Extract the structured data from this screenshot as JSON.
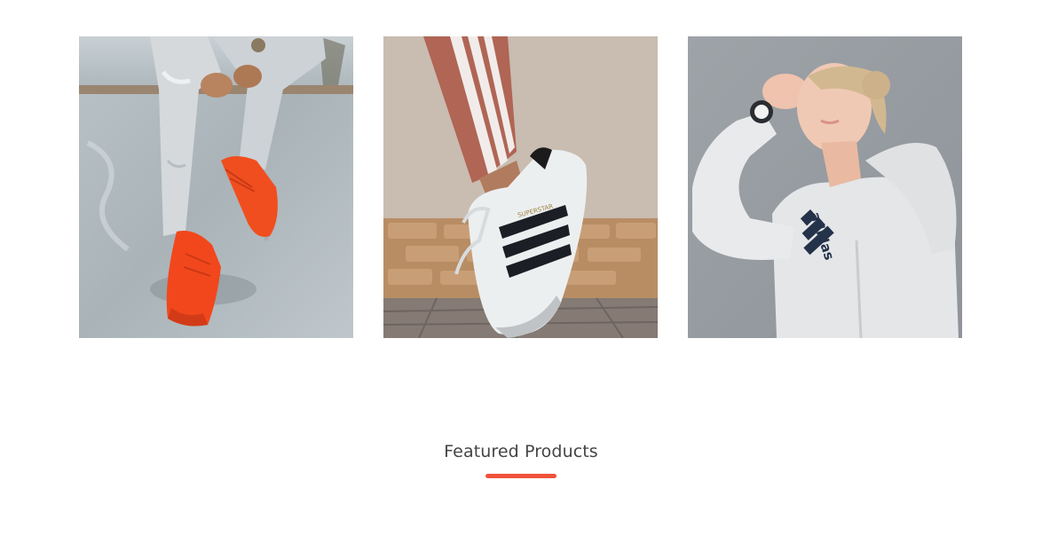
{
  "gallery": {
    "items": [
      {
        "id": "sneakers-red",
        "icon": "photo-red-sneakers"
      },
      {
        "id": "superstar-shoe",
        "icon": "photo-superstar-sneaker",
        "shoe_text": "SUPERSTAR"
      },
      {
        "id": "adidas-hoodie",
        "icon": "photo-woman-hoodie",
        "brand_text": "adidas"
      }
    ]
  },
  "featured": {
    "title": "Featured Products",
    "accent_color": "#f0513a"
  }
}
